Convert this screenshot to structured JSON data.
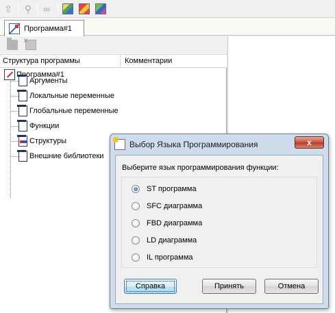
{
  "toolbar": {
    "items": [
      {
        "name": "grey-tool-icon-1",
        "glyph": "⇧"
      },
      {
        "name": "pin-icon",
        "glyph": "⚲"
      },
      {
        "name": "glasses-icon",
        "glyph": "∞"
      },
      {
        "name": "view-icon-1"
      },
      {
        "name": "view-icon-2"
      },
      {
        "name": "view-icon-3"
      }
    ]
  },
  "tabs": [
    {
      "label": "Программа#1"
    }
  ],
  "tree_panel": {
    "col_structure": "Структура программы",
    "col_comments": "Комментарии",
    "root": "Программа#1",
    "items": [
      {
        "label": "Аргументы"
      },
      {
        "label": "Локальные переменные"
      },
      {
        "label": "Глобальные переменные"
      },
      {
        "label": "Функции"
      },
      {
        "label": "Структуры"
      },
      {
        "label": "Внешние библиотеки"
      }
    ]
  },
  "dialog": {
    "title": "Выбор Языка Программирования",
    "close_glyph": "x",
    "prompt": "Выберите язык программирования функции:",
    "options": [
      {
        "label": "ST программа",
        "checked": true
      },
      {
        "label": "SFC диаграмма",
        "checked": false
      },
      {
        "label": "FBD диаграмма",
        "checked": false
      },
      {
        "label": "LD диаграмма",
        "checked": false
      },
      {
        "label": "IL программа",
        "checked": false
      }
    ],
    "selected": "ST программа",
    "buttons": {
      "help": "Справка",
      "accept": "Принять",
      "cancel": "Отмена"
    }
  },
  "colors": {
    "dialog_frame": "#cfdcec",
    "close_button": "#c7513f",
    "tab_strip": "#fbfbf4"
  }
}
